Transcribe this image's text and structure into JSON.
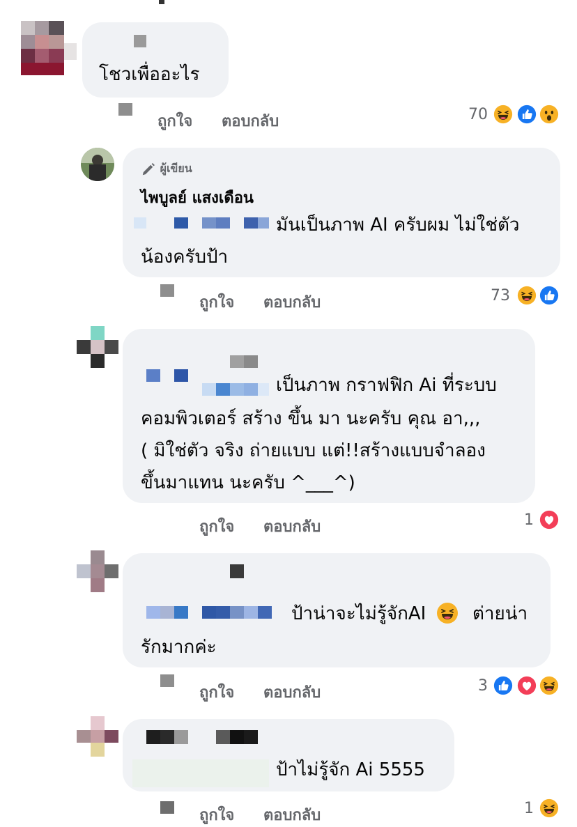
{
  "comments": [
    {
      "text": "โชวเพื่ออะไร",
      "like_label": "ถูกใจ",
      "reply_label": "ตอบกลับ",
      "reaction_count": "70",
      "reactions": [
        "haha-icon",
        "like-icon",
        "wow-icon"
      ]
    },
    {
      "author_badge": "ผู้เขียน",
      "author_name": "ไพบูลย์ แสงเดือน",
      "text_lines": [
        "มันเป็นภาพ AI ครับผม ไม่ใช่ตัว",
        "น้องครับป้า"
      ],
      "like_label": "ถูกใจ",
      "reply_label": "ตอบกลับ",
      "reaction_count": "73",
      "reactions": [
        "haha-icon",
        "like-icon"
      ]
    },
    {
      "text_lines": [
        "เป็นภาพ กราฟฟิก Ai ที่ระบบ",
        "คอมพิวเตอร์ สร้าง ขึ้น มา นะครับ คุณ อา,,,",
        "( มิใช่ตัว จริง ถ่ายแบบ  แต่!!สร้างแบบจำลอง",
        "ขึ้นมาแทน นะครับ ^___^)"
      ],
      "like_label": "ถูกใจ",
      "reply_label": "ตอบกลับ",
      "reaction_count": "1",
      "reactions": [
        "love-icon"
      ]
    },
    {
      "text_lines": [
        "ป้าน่าจะไม่รู้จักAI",
        "ต่ายน่า",
        "รักมากค่ะ"
      ],
      "like_label": "ถูกใจ",
      "reply_label": "ตอบกลับ",
      "reaction_count": "3",
      "reactions": [
        "like-icon",
        "love-icon",
        "haha-icon"
      ]
    },
    {
      "text": "ป้าไม่รู้จัก Ai 5555",
      "like_label": "ถูกใจ",
      "reply_label": "ตอบกลับ",
      "reaction_count": "1",
      "reactions": [
        "haha-icon"
      ]
    }
  ],
  "colors": {
    "bubble": "#f0f2f5",
    "secondary_text": "#65676b",
    "like_blue": "#1877f2",
    "love_red": "#f33e58",
    "haha_yellow": "#f7b125"
  }
}
